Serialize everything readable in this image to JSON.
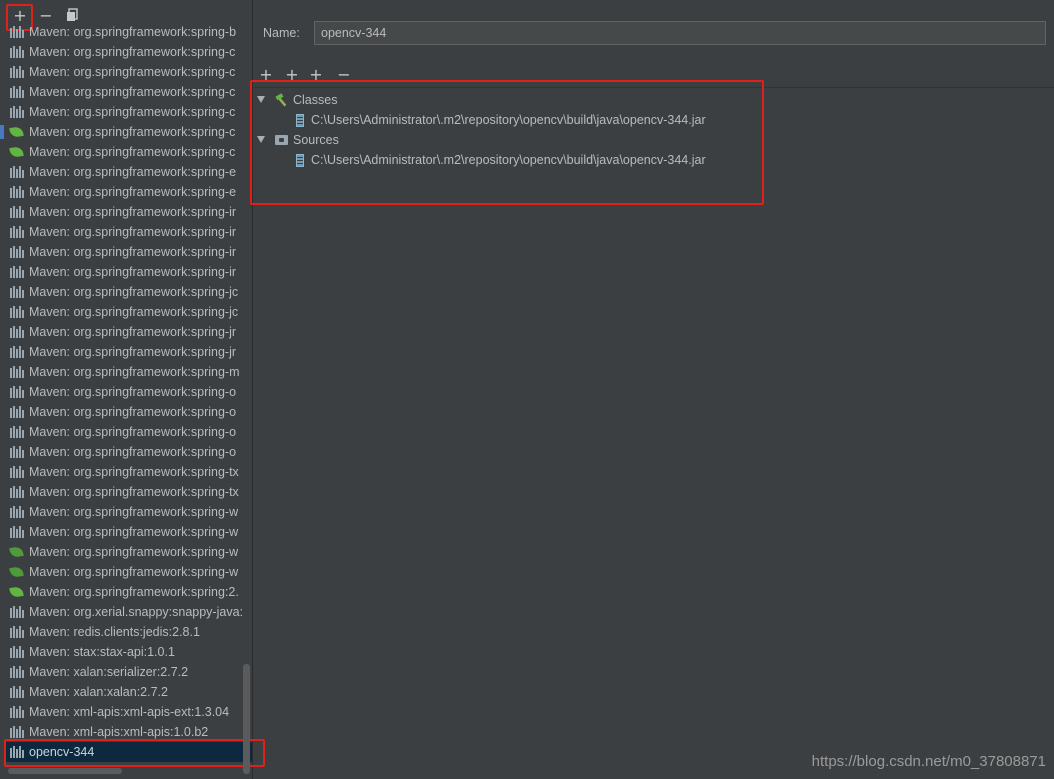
{
  "left_toolbar": {
    "add_symbol": "+",
    "remove_symbol": "−",
    "copy_icon": "copy-icon"
  },
  "libraries": [
    {
      "label": "Maven: org.springframework:spring-b",
      "icon": "library-icon"
    },
    {
      "label": "Maven: org.springframework:spring-c",
      "icon": "library-icon"
    },
    {
      "label": "Maven: org.springframework:spring-c",
      "icon": "library-icon"
    },
    {
      "label": "Maven: org.springframework:spring-c",
      "icon": "library-icon"
    },
    {
      "label": "Maven: org.springframework:spring-c",
      "icon": "library-icon"
    },
    {
      "label": "Maven: org.springframework:spring-c",
      "icon": "spring-leaf-icon"
    },
    {
      "label": "Maven: org.springframework:spring-c",
      "icon": "spring-leaf-icon"
    },
    {
      "label": "Maven: org.springframework:spring-e",
      "icon": "library-icon"
    },
    {
      "label": "Maven: org.springframework:spring-e",
      "icon": "library-icon"
    },
    {
      "label": "Maven: org.springframework:spring-ir",
      "icon": "library-icon"
    },
    {
      "label": "Maven: org.springframework:spring-ir",
      "icon": "library-icon"
    },
    {
      "label": "Maven: org.springframework:spring-ir",
      "icon": "library-icon"
    },
    {
      "label": "Maven: org.springframework:spring-ir",
      "icon": "library-icon"
    },
    {
      "label": "Maven: org.springframework:spring-jc",
      "icon": "library-icon"
    },
    {
      "label": "Maven: org.springframework:spring-jc",
      "icon": "library-icon"
    },
    {
      "label": "Maven: org.springframework:spring-jr",
      "icon": "library-icon"
    },
    {
      "label": "Maven: org.springframework:spring-jr",
      "icon": "library-icon"
    },
    {
      "label": "Maven: org.springframework:spring-m",
      "icon": "library-icon"
    },
    {
      "label": "Maven: org.springframework:spring-o",
      "icon": "library-icon"
    },
    {
      "label": "Maven: org.springframework:spring-o",
      "icon": "library-icon"
    },
    {
      "label": "Maven: org.springframework:spring-o",
      "icon": "library-icon"
    },
    {
      "label": "Maven: org.springframework:spring-o",
      "icon": "library-icon"
    },
    {
      "label": "Maven: org.springframework:spring-tx",
      "icon": "library-icon"
    },
    {
      "label": "Maven: org.springframework:spring-tx",
      "icon": "library-icon"
    },
    {
      "label": "Maven: org.springframework:spring-w",
      "icon": "library-icon"
    },
    {
      "label": "Maven: org.springframework:spring-w",
      "icon": "library-icon"
    },
    {
      "label": "Maven: org.springframework:spring-w",
      "icon": "spring-web-icon"
    },
    {
      "label": "Maven: org.springframework:spring-w",
      "icon": "spring-web-icon"
    },
    {
      "label": "Maven: org.springframework:spring:2.",
      "icon": "spring-leaf-icon"
    },
    {
      "label": "Maven: org.xerial.snappy:snappy-java:",
      "icon": "library-icon"
    },
    {
      "label": "Maven: redis.clients:jedis:2.8.1",
      "icon": "library-icon"
    },
    {
      "label": "Maven: stax:stax-api:1.0.1",
      "icon": "library-icon"
    },
    {
      "label": "Maven: xalan:serializer:2.7.2",
      "icon": "library-icon"
    },
    {
      "label": "Maven: xalan:xalan:2.7.2",
      "icon": "library-icon"
    },
    {
      "label": "Maven: xml-apis:xml-apis-ext:1.3.04",
      "icon": "library-icon"
    },
    {
      "label": "Maven: xml-apis:xml-apis:1.0.b2",
      "icon": "library-icon"
    },
    {
      "label": "opencv-344",
      "icon": "library-icon",
      "selected": true
    }
  ],
  "detail": {
    "name_label": "Name:",
    "name_value": "opencv-344",
    "toolbar": {
      "add": "+",
      "add_alt": "+",
      "add_more": "+",
      "remove": "−"
    },
    "classes_label": "Classes",
    "classes_path": "C:\\Users\\Administrator\\.m2\\repository\\opencv\\build\\java\\opencv-344.jar",
    "sources_label": "Sources",
    "sources_path": "C:\\Users\\Administrator\\.m2\\repository\\opencv\\build\\java\\opencv-344.jar"
  },
  "watermark": "https://blog.csdn.net/m0_37808871",
  "colors": {
    "background": "#3c3f41",
    "highlight": "#e0201b",
    "selection": "#0d293e",
    "spring_green": "#62b543"
  }
}
